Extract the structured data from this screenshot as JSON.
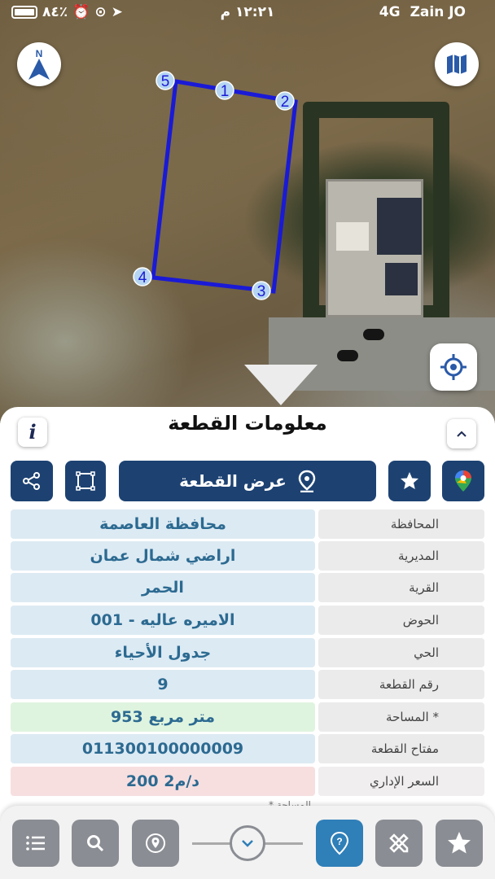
{
  "status_bar": {
    "battery": "٨٤٪",
    "time": "١٢:٢١ م",
    "network": "4G",
    "carrier": "Zain JO"
  },
  "map": {
    "vertices": [
      "1",
      "2",
      "3",
      "4",
      "5"
    ],
    "north_label": "N"
  },
  "panel": {
    "title": "معلومات القطعة",
    "info_label": "i",
    "view_plot_label": "عرض القطعة"
  },
  "rows": [
    {
      "label": "المحافظة",
      "value": "محافظة العاصمة"
    },
    {
      "label": "المديرية",
      "value": "اراضي شمال عمان"
    },
    {
      "label": "القرية",
      "value": "الحمر"
    },
    {
      "label": "الحوض",
      "value": "الاميره عاليه - 001"
    },
    {
      "label": "الحي",
      "value": "جدول الأحياء"
    },
    {
      "label": "رقم القطعة",
      "value": "9"
    },
    {
      "label": "المساحة *",
      "value": "953  متر مربع"
    },
    {
      "label": "مفتاح القطعة",
      "value": "011300100000009"
    },
    {
      "label": "السعر الإداري",
      "value": "200 د/م2"
    }
  ],
  "footnote": "* المساحة ... ... ... ...",
  "colors": {
    "accent": "#1d4272",
    "plot_line": "#1a1ad6",
    "active_tool": "#2f7fb8"
  }
}
